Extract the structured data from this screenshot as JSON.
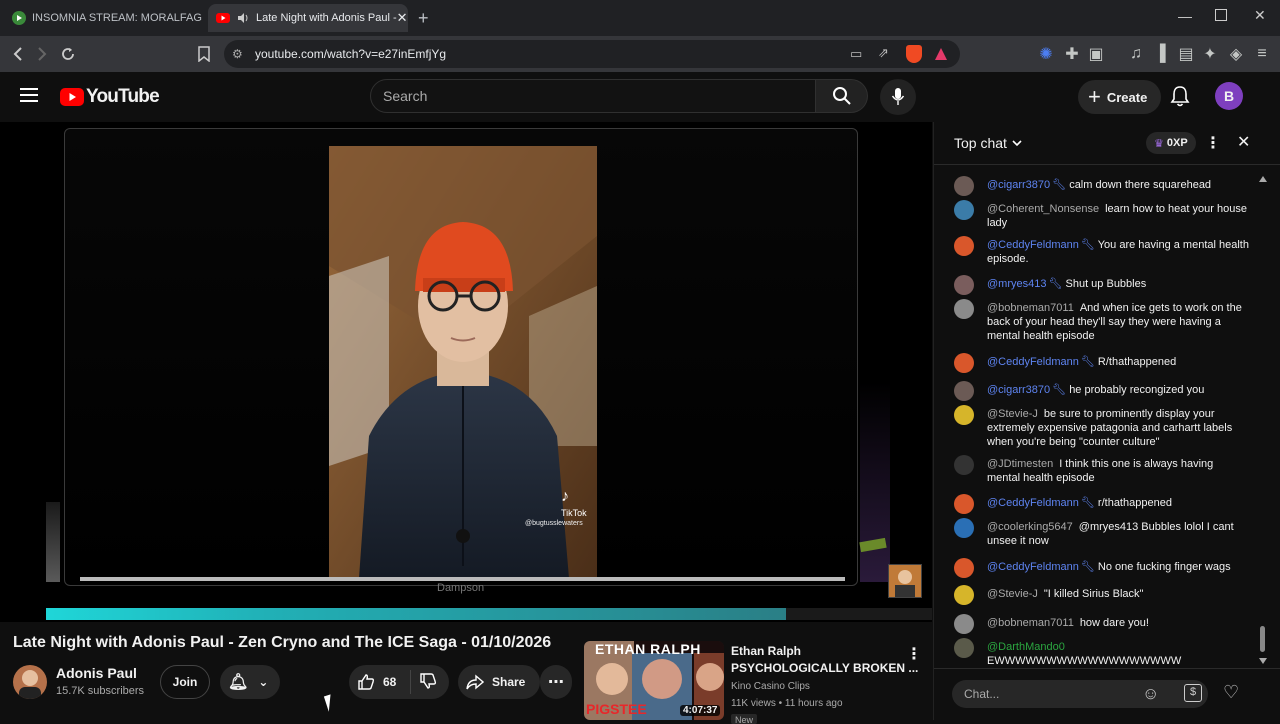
{
  "browser": {
    "tabs": [
      {
        "title": "INSOMNIA STREAM: MORALFAG EDI",
        "active": false
      },
      {
        "title": "Late Night with Adonis Paul -",
        "active": true
      }
    ],
    "url": "youtube.com/watch?v=e27inEmfjYg"
  },
  "header": {
    "logo": "YouTube",
    "search_placeholder": "Search",
    "create_label": "Create",
    "avatar_initial": "B"
  },
  "video": {
    "watermark_app": "TikTok",
    "watermark_user": "@bugtusslewaters",
    "caption": "Dampson",
    "progress": 0.835
  },
  "below_video": {
    "title": "Late Night with Adonis Paul - Zen Cryno and The ICE Saga - 01/10/2026",
    "channel_name": "Adonis Paul",
    "subscribers": "15.7K subscribers",
    "join_label": "Join",
    "like_count": "68",
    "share_label": "Share"
  },
  "recommended": {
    "thumb_text": "ETHAN RALPH",
    "thumb_overlay": "PIGSTEE",
    "duration": "4:07:37",
    "channel_title": "Ethan Ralph",
    "video_title": "PSYCHOLOGICALLY BROKEN ...",
    "channel": "Kino Casino Clips",
    "meta": "11K views • 11 hours ago",
    "badge": "New"
  },
  "chat": {
    "header": "Top chat",
    "xp": "0XP",
    "input_placeholder": "Chat...",
    "messages": [
      {
        "author": "@cigarr3870",
        "mod": true,
        "text": "calm down there squarehead",
        "color": "#6b5a55"
      },
      {
        "author": "@Coherent_Nonsense",
        "mod": false,
        "text": "learn how to heat your house lady",
        "color": "#3b7ca8"
      },
      {
        "author": "@CeddyFeldmann",
        "mod": true,
        "text": "You are having a mental health episode.",
        "color": "#d9572b"
      },
      {
        "author": "@mryes413",
        "mod": true,
        "text": "Shut up Bubbles",
        "color": "#7a5d5d"
      },
      {
        "author": "@bobneman7011",
        "mod": false,
        "text": "And when ice gets to work on the back of your head they'll say they were having a mental health episode",
        "color": "#8a8a8a"
      },
      {
        "author": "@CeddyFeldmann",
        "mod": true,
        "text": "R/thathappened",
        "color": "#d9572b"
      },
      {
        "author": "@cigarr3870",
        "mod": true,
        "text": "he probably recongized you",
        "color": "#6b5a55"
      },
      {
        "author": "@Stevie-J",
        "mod": false,
        "text": "be sure to prominently display your extremely expensive patagonia and carhartt labels when you're being \"counter culture\"",
        "color": "#d6b52a"
      },
      {
        "author": "@JDtimesten",
        "mod": false,
        "text": "I think this one is always having mental health episode",
        "color": "#333333"
      },
      {
        "author": "@CeddyFeldmann",
        "mod": true,
        "text": "r/thathappened",
        "color": "#d9572b"
      },
      {
        "author": "@coolerking5647",
        "mod": false,
        "text": "@mryes413 Bubbles lolol I cant unsee it now",
        "color": "#2a6fb5"
      },
      {
        "author": "@CeddyFeldmann",
        "mod": true,
        "text": "No one fucking finger wags",
        "color": "#d9572b"
      },
      {
        "author": "@Stevie-J",
        "mod": false,
        "text": "\"I killed Sirius Black\"",
        "color": "#d6b52a"
      },
      {
        "author": "@bobneman7011",
        "mod": false,
        "text": "how dare you!",
        "color": "#8a8a8a"
      },
      {
        "author": "@DarthMando0",
        "mod": false,
        "green": true,
        "text": "EWWWWWWWWWWWWWWWWWW",
        "color": "#5a5a4a"
      }
    ]
  },
  "colors": {
    "accent": "#ff0000",
    "mod_name": "#5e84f1",
    "member_name": "#2ba640",
    "progress": "#1fd6d8"
  }
}
